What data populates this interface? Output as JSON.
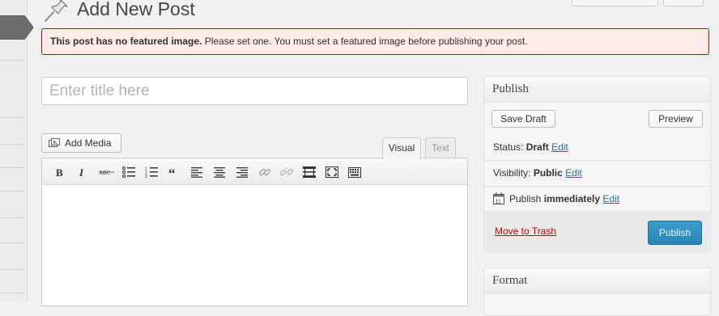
{
  "header": {
    "title": "Add New Post"
  },
  "notice": {
    "bold": "This post has no featured image.",
    "text": " Please set one. You must set a featured image before publishing your post."
  },
  "title_field": {
    "placeholder": "Enter title here",
    "value": ""
  },
  "editor": {
    "add_media_label": "Add Media",
    "tabs": [
      {
        "label": "Visual",
        "active": true
      },
      {
        "label": "Text",
        "active": false
      }
    ],
    "toolbar_icons": [
      "bold-icon",
      "italic-icon",
      "strikethrough-icon",
      "bullet-list-icon",
      "numbered-list-icon",
      "blockquote-icon",
      "align-left-icon",
      "align-center-icon",
      "align-right-icon",
      "insert-link-icon",
      "unlink-icon",
      "read-more-icon",
      "fullscreen-icon",
      "kitchen-sink-icon"
    ]
  },
  "publish_box": {
    "title": "Publish",
    "save_draft_label": "Save Draft",
    "preview_label": "Preview",
    "status_label": "Status:",
    "status_value": "Draft",
    "visibility_label": "Visibility:",
    "visibility_value": "Public",
    "schedule_label": "Publish",
    "schedule_value": "immediately",
    "edit_label": "Edit",
    "trash_label": "Move to Trash",
    "publish_label": "Publish"
  },
  "format_box": {
    "title": "Format"
  },
  "colors": {
    "link": "#21759b",
    "error_border": "#cc0000",
    "error_bg": "#ffebe8",
    "primary_button": "#2a85b3",
    "trash": "#cc0000"
  }
}
